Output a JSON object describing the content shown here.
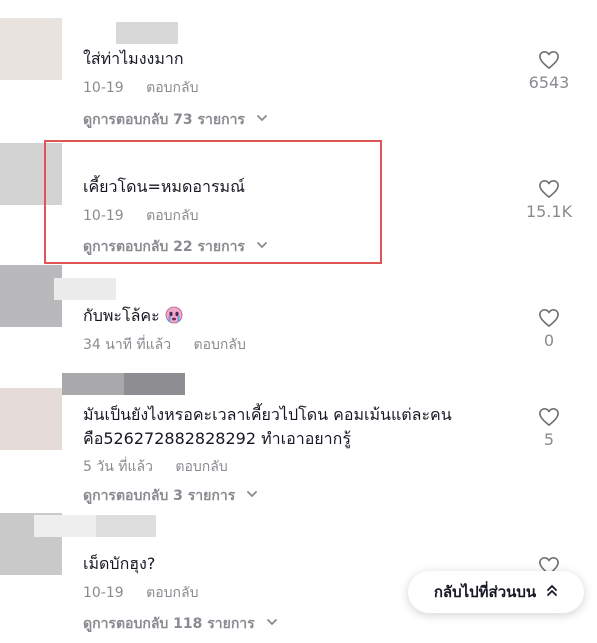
{
  "colors": {
    "accent_highlight": "#e05555",
    "meta_gray": "#8a8b91",
    "text": "#161823"
  },
  "comments": [
    {
      "text": "ใส่ท่าไมงงมาก",
      "date": "10-19",
      "reply": "ตอบกลับ",
      "view_replies": "ดูการตอบกลับ 73 รายการ",
      "likes": "6543",
      "emoji": ""
    },
    {
      "text": "เคี้ยวโดน=หมดอารมณ์",
      "date": "10-19",
      "reply": "ตอบกลับ",
      "view_replies": "ดูการตอบกลับ 22 รายการ",
      "likes": "15.1K",
      "emoji": ""
    },
    {
      "text": "กับพะโล้คะ",
      "date": "34 นาที ที่แล้ว",
      "reply": "ตอบกลับ",
      "view_replies": "",
      "likes": "0",
      "emoji": "crying-face"
    },
    {
      "text": "มันเป็นยังไงหรอคะเวลาเคี้ยวไปโดน คอมเม้นแต่ละคน",
      "text2": "คือ526272882828292 ทำเอาอยากรู้",
      "date": "5 วัน ที่แล้ว",
      "reply": "ตอบกลับ",
      "view_replies": "ดูการตอบกลับ 3 รายการ",
      "likes": "5",
      "emoji": ""
    },
    {
      "text": "เม็ดบักฮุง?",
      "date": "10-19",
      "reply": "ตอบกลับ",
      "view_replies": "ดูการตอบกลับ 118 รายการ",
      "likes": "",
      "emoji": ""
    }
  ],
  "back_to_top": "กลับไปที่ส่วนบน",
  "icons": {
    "like": "heart-icon",
    "chevron": "chevron-down-icon",
    "back_top": "double-chevron-up-icon"
  }
}
